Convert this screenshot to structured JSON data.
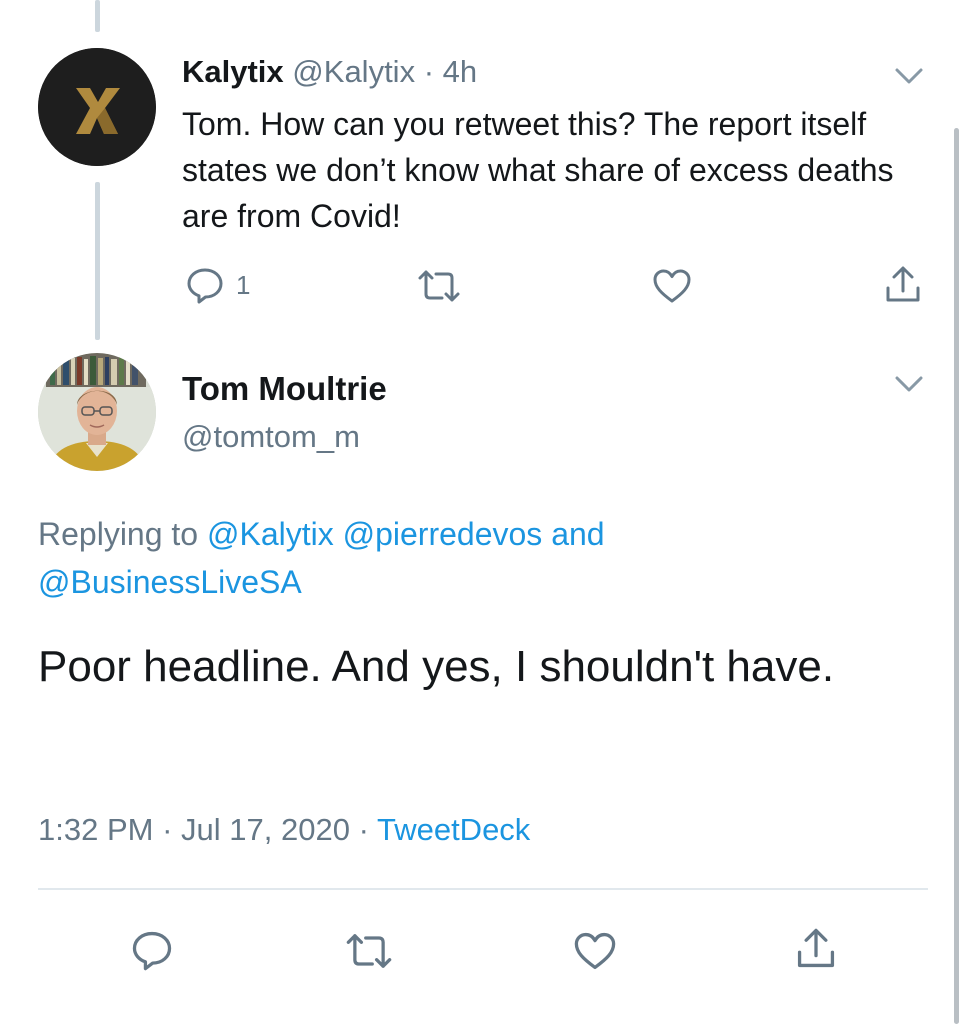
{
  "reply_tweet": {
    "display_name": "Kalytix",
    "handle": "@Kalytix",
    "separator": "·",
    "time_ago": "4h",
    "text": "Tom. How can you retweet this? The report itself states we don’t know what share of excess deaths are from Covid!",
    "reply_count": "1",
    "avatar_letter": "X",
    "avatar_icon": "kalytix-logo",
    "icons": {
      "reply": "reply-icon",
      "retweet": "retweet-icon",
      "like": "heart-icon",
      "share": "share-icon",
      "menu": "chevron-down-icon"
    }
  },
  "main_tweet": {
    "display_name": "Tom Moultrie",
    "handle": "@tomtom_m",
    "replying_prefix": "Replying to",
    "mentions": [
      "@Kalytix",
      "@pierredevos",
      "@BusinessLiveSA"
    ],
    "replying_joiner": "and",
    "text": "Poor headline. And yes, I shouldn't have.",
    "time": "1:32 PM",
    "date": "Jul 17, 2020",
    "separator": "·",
    "source": "TweetDeck",
    "avatar_icon": "profile-photo"
  },
  "colors": {
    "text": "#14171a",
    "secondary": "#657786",
    "link": "#1b95e0",
    "thread_line": "#ccd6dd",
    "divider": "#e1e8ed",
    "kalytix_gold": "#b08a3e"
  }
}
